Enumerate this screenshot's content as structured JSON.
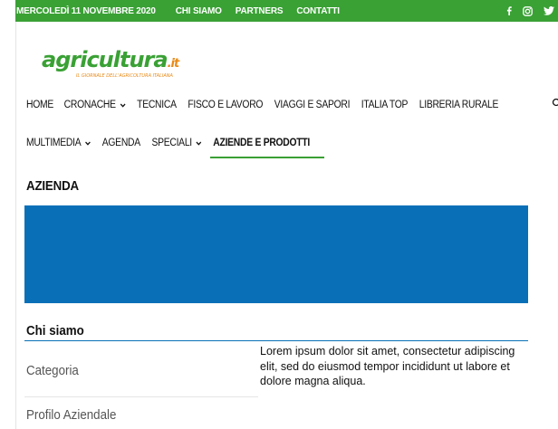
{
  "topbar": {
    "date": "MERCOLEDÌ 11 NOVEMBRE 2020",
    "links": [
      "CHI SIAMO",
      "PARTNERS",
      "CONTATTI"
    ],
    "social": [
      "facebook-icon",
      "instagram-icon",
      "twitter-icon"
    ],
    "background": "#3aa135"
  },
  "logo": {
    "name_part1": "agricultura",
    "name_part2": ".it",
    "tagline": "IL GIORNALE DELL'AGRICOLTURA ITALIANA"
  },
  "nav": {
    "row1": [
      "HOME",
      "CRONACHE",
      "TECNICA",
      "FISCO E LAVORO",
      "VIAGGI E SAPORI",
      "ITALIA TOP",
      "LIBRERIA RURALE"
    ],
    "row2": [
      "MULTIMEDIA",
      "AGENDA",
      "SPECIALI",
      "AZIENDE E PRODOTTI"
    ]
  },
  "page": {
    "heading": "AZIENDA",
    "banner_color": "#0970b8",
    "section_title": "Chi siamo",
    "description": "Lorem ipsum dolor sit amet, consectetur adipiscing elit, sed do eiusmod tempor incididunt ut labore et dolore magna aliqua.",
    "fields": [
      "Categoria",
      "Profilo Aziendale"
    ]
  },
  "colors": {
    "accent_green": "#3aa135",
    "accent_blue": "#0970b8"
  }
}
